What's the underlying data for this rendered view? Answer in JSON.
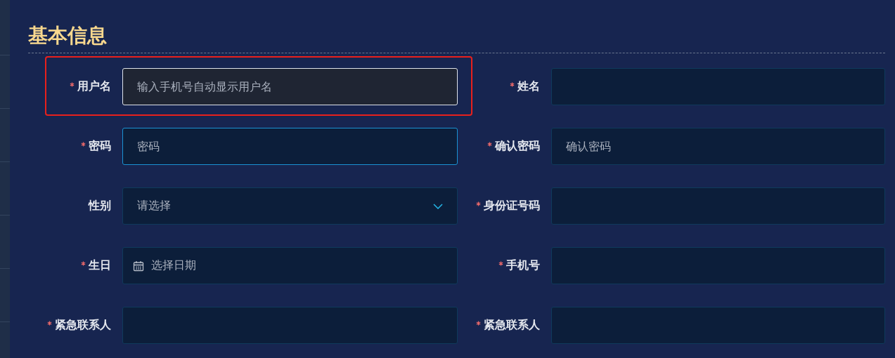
{
  "section_title": "基本信息",
  "fields": [
    {
      "label": "用户名",
      "required": true,
      "kind": "text",
      "placeholder": "输入手机号自动显示用户名",
      "highlighted": true,
      "hovered": true,
      "focused": false
    },
    {
      "label": "姓名",
      "required": true,
      "kind": "text",
      "highlighted": false,
      "hovered": false,
      "focused": false
    },
    {
      "label": "密码",
      "required": true,
      "kind": "text",
      "placeholder": "密码",
      "highlighted": false,
      "hovered": false,
      "focused": true
    },
    {
      "label": "确认密码",
      "required": true,
      "kind": "text",
      "placeholder": "确认密码",
      "highlighted": false,
      "hovered": false,
      "focused": false
    },
    {
      "label": "性别",
      "required": false,
      "kind": "select",
      "placeholder": "请选择",
      "highlighted": false,
      "hovered": false,
      "focused": false
    },
    {
      "label": "身份证号码",
      "required": true,
      "kind": "text",
      "highlighted": false,
      "hovered": false,
      "focused": false
    },
    {
      "label": "生日",
      "required": true,
      "kind": "date",
      "placeholder": "选择日期",
      "highlighted": false,
      "hovered": false,
      "focused": false
    },
    {
      "label": "手机号",
      "required": true,
      "kind": "text",
      "highlighted": false,
      "hovered": false,
      "focused": false
    },
    {
      "label": "紧急联系人",
      "required": true,
      "kind": "text",
      "highlighted": false,
      "hovered": false,
      "focused": false
    },
    {
      "label": "紧急联系人",
      "required": true,
      "kind": "text",
      "highlighted": false,
      "hovered": false,
      "focused": false
    }
  ]
}
